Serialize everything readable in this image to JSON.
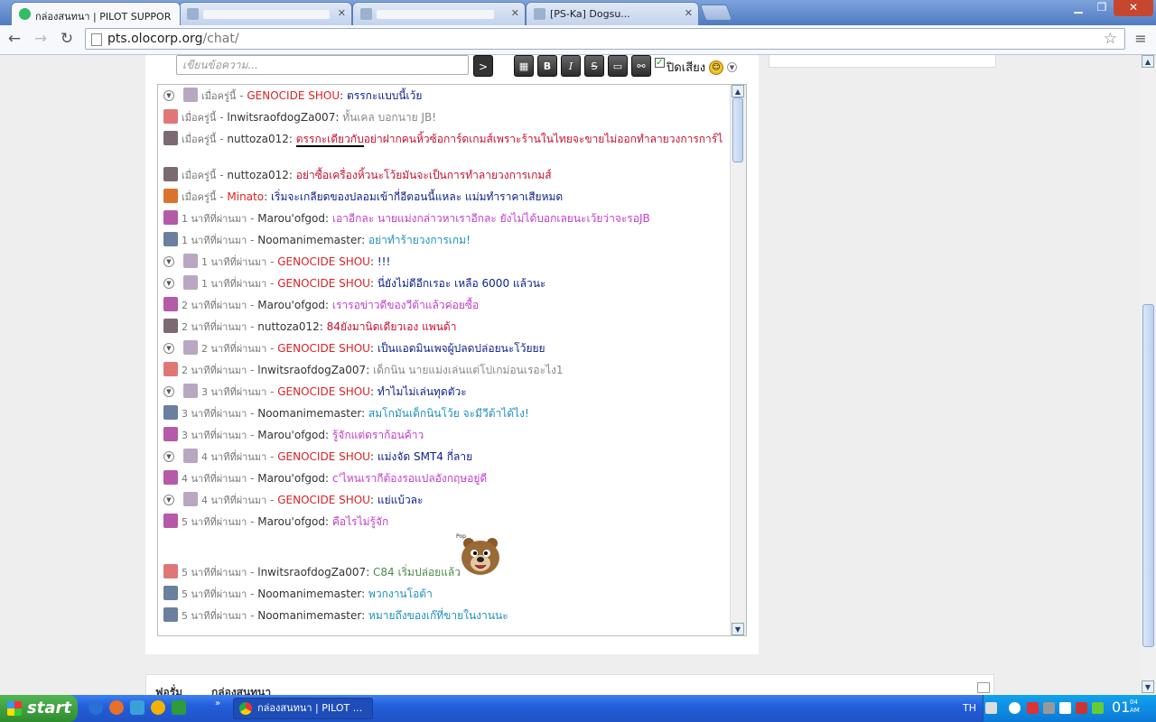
{
  "browser": {
    "tabs": [
      {
        "title": "กล่องสนทนา | PILOT SUPPOR",
        "active": true
      },
      {
        "title": "",
        "active": false
      },
      {
        "title": "",
        "active": false
      },
      {
        "title": "[PS-Ka] Dogsu...",
        "active": false
      }
    ],
    "url_host": "pts.olocorp.org",
    "url_path": "/chat/"
  },
  "chat": {
    "input_placeholder": "เขียนข้อความ...",
    "send_label": ">",
    "format_buttons": [
      "▦",
      "B",
      "I",
      "S",
      "▭",
      "⚯"
    ],
    "mute_label": "ปิดเสียง",
    "messages": [
      {
        "toggle": true,
        "time": "เมื่อครู่นี้",
        "user": "GENOCIDE SHOU",
        "admin": true,
        "text": "ตรรกะแบบนี้เว้ย",
        "color": "#0b1e8c",
        "avatar": "#b9a7c2"
      },
      {
        "toggle": false,
        "time": "เมื่อครู่นี้",
        "user": "lnwitsraofdogZa007",
        "admin": false,
        "text": "ทั้นเคล บอกนาย JB!",
        "color": "#888888",
        "avatar": "#e07777"
      },
      {
        "toggle": false,
        "time": "เมื่อครู่นี้",
        "user": "nuttoza012",
        "admin": false,
        "text_pre": "ตรรกะเดียวกับ",
        "text_post": "อย่าฝากคนหิ้วซ้อการ์ดเกมส์เพราะร้านในไทยจะขายไม่ออกทำลายวงการการ์ไ",
        "color": "#c8102e",
        "avatar": "#7b6a72",
        "tall": true
      },
      {
        "toggle": false,
        "time": "เมื่อครู่นี้",
        "user": "nuttoza012",
        "admin": false,
        "text": "อย่าซื้อเครื่องหิ้วนะโว้ยมันจะเป็นการทำลายวงการเกมส์",
        "color": "#c8102e",
        "avatar": "#7b6a72"
      },
      {
        "toggle": false,
        "time": "เมื่อครู่นี้",
        "user": "Minato",
        "admin": true,
        "text": "เริ่มจะเกลียดของปลอมเข้ากี่อีตอนนี้แหละ แม่มทำราคาเสียหมด",
        "color": "#0b1e8c",
        "avatar": "#d9742f"
      },
      {
        "toggle": false,
        "time": "1 นาทีที่ผ่านมา",
        "user": "Marou'ofgod",
        "admin": false,
        "text": "เอาอีกละ นายแม่งกล่าวหาเราอีกละ ยังไม่ได้บอกเลยนะเว้ยว่าจะรอJB",
        "color": "#c23ccf",
        "avatar": "#b45aa8"
      },
      {
        "toggle": false,
        "time": "1 นาทีที่ผ่านมา",
        "user": "Noomanimemaster",
        "admin": false,
        "text": "อย่าทำร้ายวงการเกม!",
        "color": "#1d8fc0",
        "avatar": "#6b7f9e"
      },
      {
        "toggle": true,
        "time": "1 นาทีที่ผ่านมา",
        "user": "GENOCIDE SHOU",
        "admin": true,
        "text": "!!!",
        "color": "#0b1e8c",
        "avatar": "#b9a7c2"
      },
      {
        "toggle": true,
        "time": "1 นาทีที่ผ่านมา",
        "user": "GENOCIDE SHOU",
        "admin": true,
        "text": "นี่ยังไม่ดีอีกเรอะ เหลือ 6000 แล้วนะ",
        "color": "#0b1e8c",
        "avatar": "#b9a7c2"
      },
      {
        "toggle": false,
        "time": "2 นาทีที่ผ่านมา",
        "user": "Marou'ofgod",
        "admin": false,
        "text": "เรารอข่าวดีของวีต้าแล้วค่อยซื้อ",
        "color": "#c23ccf",
        "avatar": "#b45aa8"
      },
      {
        "toggle": false,
        "time": "2 นาทีที่ผ่านมา",
        "user": "nuttoza012",
        "admin": false,
        "text": "84ยังมานิดเดียวเอง แพนด้า",
        "color": "#c8102e",
        "avatar": "#7b6a72"
      },
      {
        "toggle": true,
        "time": "2 นาทีที่ผ่านมา",
        "user": "GENOCIDE SHOU",
        "admin": true,
        "text": "เป็นแอดมินเพจผู้ปลดปล่อยนะโว้ยยย",
        "color": "#0b1e8c",
        "avatar": "#b9a7c2"
      },
      {
        "toggle": false,
        "time": "2 นาทีที่ผ่านมา",
        "user": "lnwitsraofdogZa007",
        "admin": false,
        "text": "เด็กนิน นายแม่งเล่นแต่โปเกม่อนเรอะไง1",
        "color": "#888888",
        "avatar": "#e07777"
      },
      {
        "toggle": true,
        "time": "3 นาทีที่ผ่านมา",
        "user": "GENOCIDE SHOU",
        "admin": true,
        "text": "ทำไมไม่เล่นทุดตัวะ",
        "color": "#0b1e8c",
        "avatar": "#b9a7c2"
      },
      {
        "toggle": false,
        "time": "3 นาทีที่ผ่านมา",
        "user": "Noomanimemaster",
        "admin": false,
        "text": "สมโกมันเด็กนินโว้ย จะมีวีต้าได้ไง!",
        "color": "#1d8fc0",
        "avatar": "#6b7f9e"
      },
      {
        "toggle": false,
        "time": "3 นาทีที่ผ่านมา",
        "user": "Marou'ofgod",
        "admin": false,
        "text": "รู้จักแต่ดราก้อนค้าว",
        "color": "#c23ccf",
        "avatar": "#b45aa8"
      },
      {
        "toggle": true,
        "time": "4 นาทีที่ผ่านมา",
        "user": "GENOCIDE SHOU",
        "admin": true,
        "text": "แม่งจัด SMT4 กี่ลาย",
        "color": "#0b1e8c",
        "avatar": "#b9a7c2"
      },
      {
        "toggle": false,
        "time": "4 นาทีที่ผ่านมา",
        "user": "Marou'ofgod",
        "admin": false,
        "text": "c'ไหนเรากีต้องรอแปลอังกฤษอยู่ดี",
        "color": "#c23ccf",
        "avatar": "#b45aa8"
      },
      {
        "toggle": true,
        "time": "4 นาทีที่ผ่านมา",
        "user": "GENOCIDE SHOU",
        "admin": true,
        "text": "แย่แบ้วละ",
        "color": "#0b1e8c",
        "avatar": "#b9a7c2"
      },
      {
        "toggle": false,
        "time": "5 นาทีที่ผ่านมา",
        "user": "Marou'ofgod",
        "admin": false,
        "text": "คือไรไม่รู้จัก",
        "color": "#c23ccf",
        "avatar": "#b45aa8"
      },
      {
        "toggle": false,
        "time": "5 นาทีที่ผ่านมา",
        "user": "lnwitsraofdogZa007",
        "admin": false,
        "text": "C84 เริ่มปล่อยแล้ว",
        "color": "#4a8a4a",
        "avatar": "#e07777",
        "spacer_before": true
      },
      {
        "toggle": false,
        "time": "5 นาทีที่ผ่านมา",
        "user": "Noomanimemaster",
        "admin": false,
        "text": "พวกงานโอต้า",
        "color": "#1d8fc0",
        "avatar": "#6b7f9e"
      },
      {
        "toggle": false,
        "time": "5 นาทีที่ผ่านมา",
        "user": "Noomanimemaster",
        "admin": false,
        "text": "หมายถึงของเก๊ที่ขายในงานนะ",
        "color": "#1d8fc0",
        "avatar": "#6b7f9e"
      }
    ],
    "sticker_caption": "Pop"
  },
  "breadcrumb": {
    "items": [
      "ฟอรั่ม",
      "กล่องสนทนา"
    ]
  },
  "taskbar": {
    "start_label": "start",
    "task_title": "กล่องสนทนา | PILOT ...",
    "lang": "TH",
    "clock_time": "01",
    "clock_ampm_top": "04",
    "clock_ampm_bottom": "AM"
  }
}
